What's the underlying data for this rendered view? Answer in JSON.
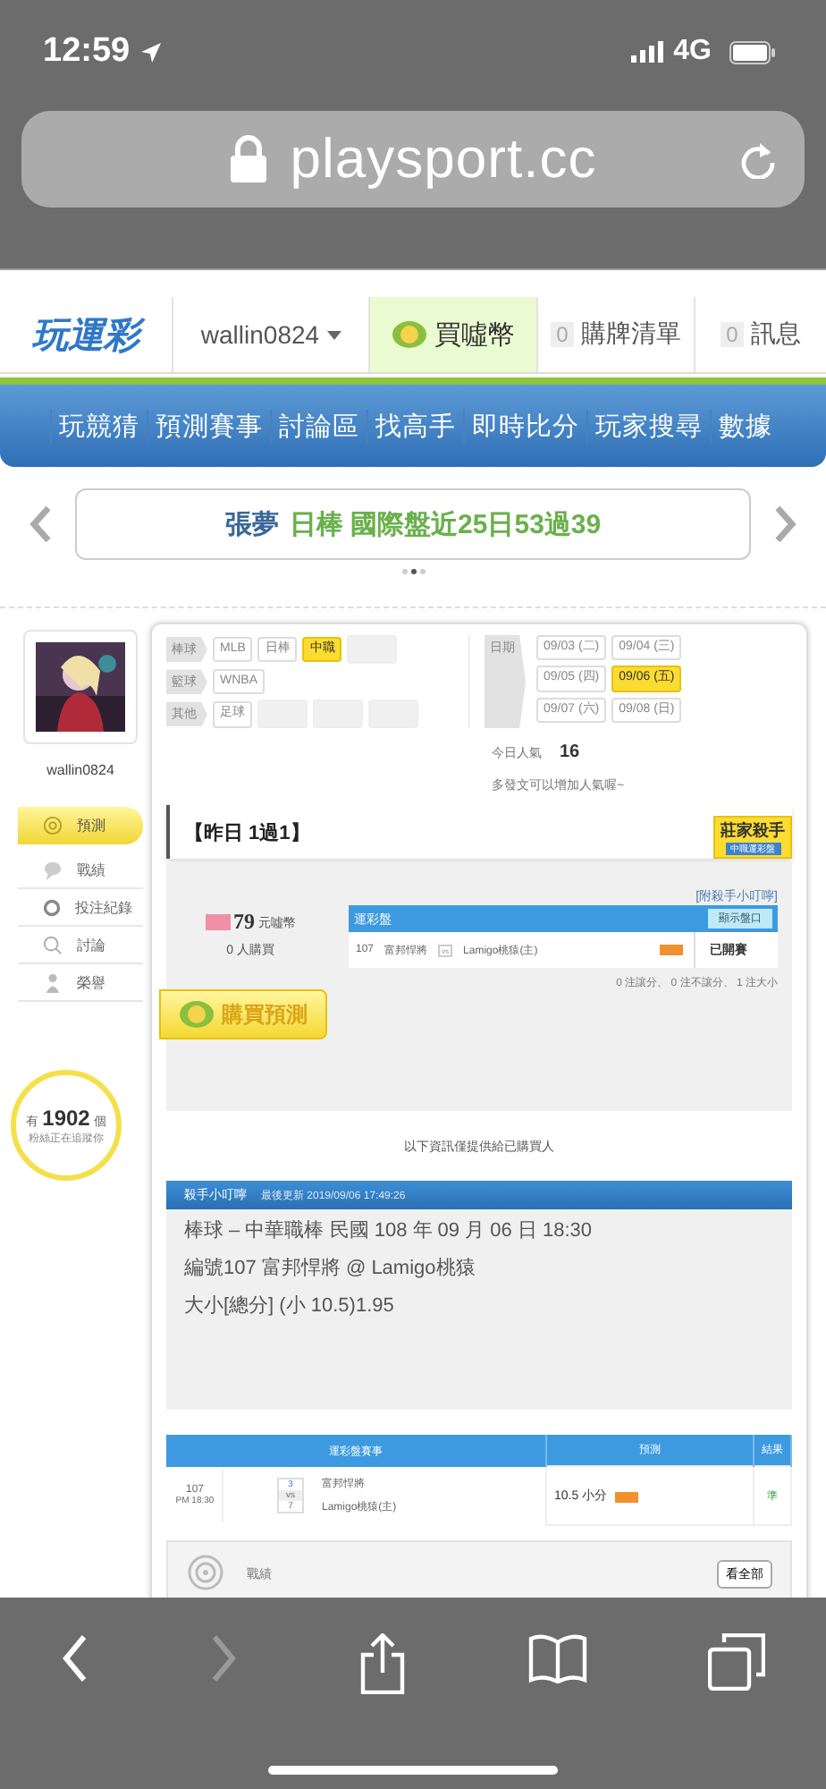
{
  "status_bar": {
    "time": "12:59",
    "network": "4G"
  },
  "address_bar": {
    "url": "playsport.cc"
  },
  "header": {
    "logo": "玩運彩",
    "username": "wallin0824",
    "buy_coins": "買噓幣",
    "cart": {
      "count": "0",
      "label": "購牌清單"
    },
    "messages": {
      "count": "0",
      "label": "訊息"
    }
  },
  "nav": [
    "玩競猜",
    "預測賽事",
    "討論區",
    "找高手",
    "即時比分",
    "玩家搜尋",
    "數據"
  ],
  "banner": {
    "name": "張夢",
    "text": "日棒 國際盤近25日53過39",
    "dots": [
      {
        "selected": false
      },
      {
        "selected": true
      },
      {
        "selected": false
      }
    ]
  },
  "sidebar": {
    "username": "wallin0824",
    "menu": [
      {
        "label": "預測",
        "selected": true
      },
      {
        "label": "戰績",
        "selected": false
      },
      {
        "label": "投注紀錄",
        "selected": false
      },
      {
        "label": "討論",
        "selected": false
      },
      {
        "label": "榮譽",
        "selected": false
      }
    ],
    "fans": {
      "prefix": "有",
      "count": "1902",
      "suffix": "個",
      "line2": "粉絲正在追蹤你"
    }
  },
  "filters": {
    "sports": [
      {
        "label": "棒球",
        "options": [
          {
            "kind": "option",
            "label": "MLB",
            "selected": false
          },
          {
            "kind": "option",
            "label": "日棒",
            "selected": false
          },
          {
            "kind": "option",
            "label": "中職",
            "selected": true
          },
          {
            "kind": "blurred"
          }
        ]
      },
      {
        "label": "籃球",
        "options": [
          {
            "kind": "option",
            "label": "WNBA",
            "selected": false
          }
        ]
      },
      {
        "label": "其他",
        "options": [
          {
            "kind": "option",
            "label": "足球",
            "selected": false
          },
          {
            "kind": "blurred"
          },
          {
            "kind": "blurred"
          },
          {
            "kind": "blurred"
          }
        ]
      }
    ],
    "date_label": "日期",
    "dates": [
      {
        "label": "09/03 (二)",
        "selected": false
      },
      {
        "label": "09/04 (三)",
        "selected": false
      },
      {
        "label": "09/05 (四)",
        "selected": false
      },
      {
        "label": "09/06 (五)",
        "selected": true
      },
      {
        "label": "09/07 (六)",
        "selected": false
      },
      {
        "label": "09/08 (日)",
        "selected": false
      }
    ]
  },
  "popularity": {
    "label": "今日人氣",
    "value": "16",
    "hint": "多發文可以增加人氣喔~"
  },
  "record": {
    "title": "【昨日 1過1】",
    "badge": "莊家殺手",
    "ribbon": "中職運彩盤"
  },
  "purchase": {
    "price": "79",
    "unit": "元噓幣",
    "buyers": "0 人購買",
    "button": "購買預測",
    "note_link": "[附殺手小叮嚀]",
    "table_title": "運彩盤",
    "show_odds": "顯示盤口",
    "game": {
      "no": "107",
      "away": "富邦悍將",
      "vs": "vs",
      "home": "Lamigo桃猿(主)",
      "status": "已開賽"
    },
    "summary": "0 注讓分、 0 注不讓分、 1 注大小"
  },
  "notice": "以下資訊僅提供給已購買人",
  "tips": {
    "title": "殺手小叮嚀",
    "updated": "最後更新 2019/09/06 17:49:26",
    "lines": [
      "棒球 – 中華職棒 民國 108 年 09 月 06 日 18:30",
      "編號107 富邦悍將 @ Lamigo桃猿",
      "大小[總分] (小 10.5)1.95"
    ]
  },
  "results": {
    "columns": [
      "運彩盤賽事",
      "預測",
      "結果"
    ],
    "rows": [
      {
        "no": "107",
        "time": "PM 18:30",
        "away_score": "3",
        "vs": "vs",
        "home_score": "7",
        "away": "富邦悍將",
        "home": "Lamigo桃猿(主)",
        "pick": "10.5 小分",
        "result": "準"
      }
    ]
  },
  "stats": {
    "title": "戰績",
    "button": "看全部"
  }
}
